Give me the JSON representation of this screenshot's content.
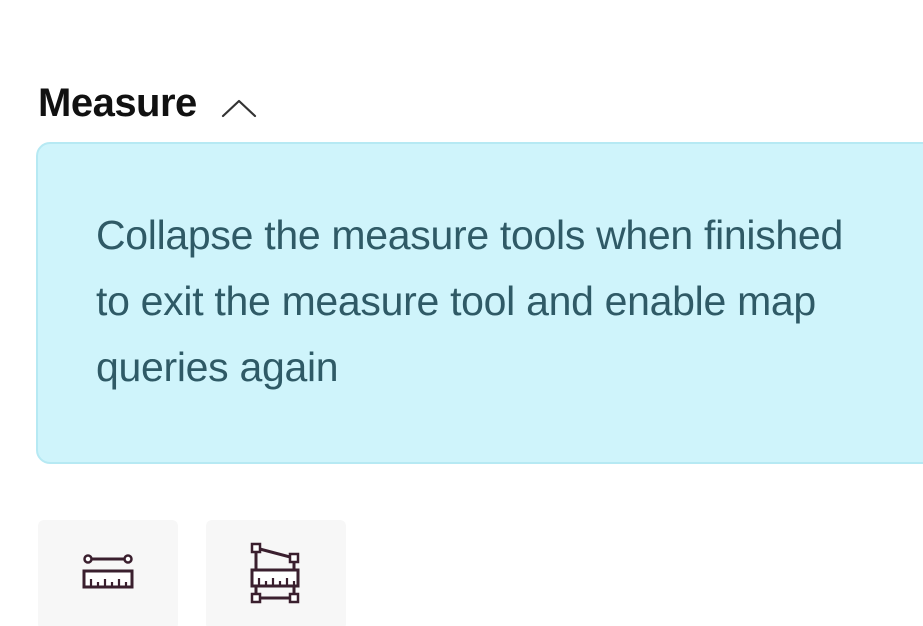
{
  "measure_panel": {
    "title": "Measure",
    "collapse_icon": "chevron-up-icon",
    "info_message": "Collapse the measure tools when finished to exit the measure tool and enable map queries again",
    "tools": [
      {
        "icon": "ruler-icon"
      },
      {
        "icon": "polygon-ruler-icon"
      }
    ]
  },
  "colors": {
    "info_background": "#cff4fb",
    "info_border": "#b6e9f3",
    "info_text": "#2f5a66",
    "title_text": "#111111",
    "tool_button_bg": "#f7f7f7"
  }
}
